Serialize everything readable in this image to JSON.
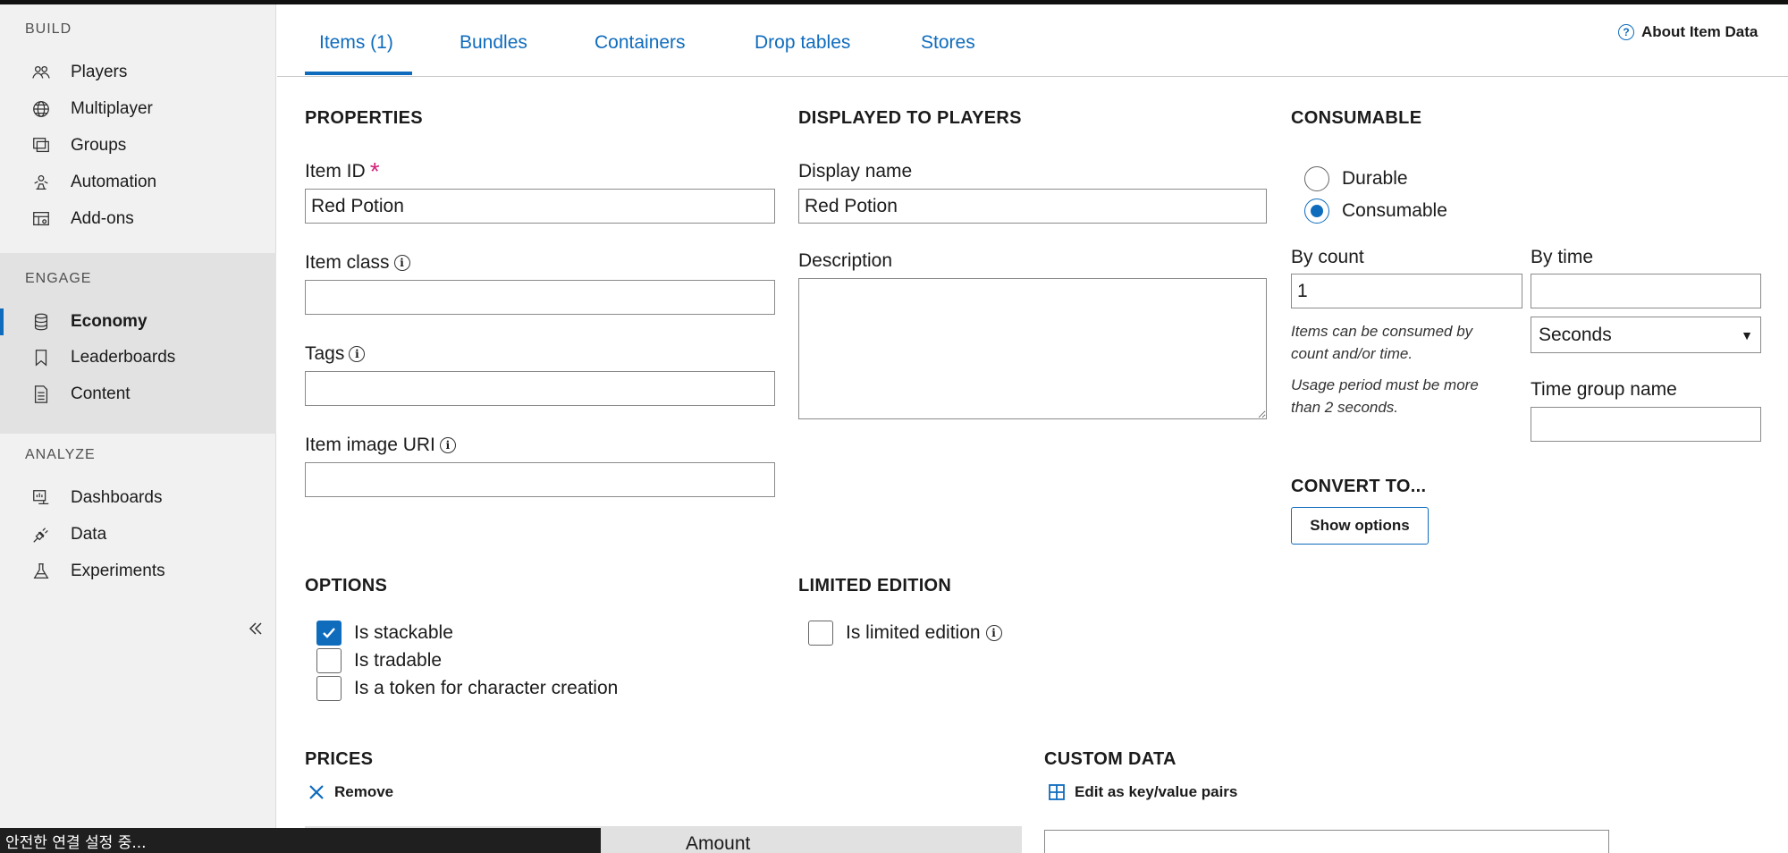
{
  "sidebar": {
    "build_title": "BUILD",
    "engage_title": "ENGAGE",
    "analyze_title": "ANALYZE",
    "build_items": [
      {
        "label": "Players",
        "icon": "players-icon"
      },
      {
        "label": "Multiplayer",
        "icon": "globe-icon"
      },
      {
        "label": "Groups",
        "icon": "groups-icon"
      },
      {
        "label": "Automation",
        "icon": "automation-icon"
      },
      {
        "label": "Add-ons",
        "icon": "add-ons-icon"
      }
    ],
    "engage_items": [
      {
        "label": "Economy",
        "icon": "database-icon",
        "active": true
      },
      {
        "label": "Leaderboards",
        "icon": "bookmark-icon"
      },
      {
        "label": "Content",
        "icon": "document-icon"
      }
    ],
    "analyze_items": [
      {
        "label": "Dashboards",
        "icon": "dashboard-icon"
      },
      {
        "label": "Data",
        "icon": "plug-icon"
      },
      {
        "label": "Experiments",
        "icon": "flask-icon"
      }
    ]
  },
  "tabs": [
    {
      "label": "Items (1)",
      "active": true
    },
    {
      "label": "Bundles"
    },
    {
      "label": "Containers"
    },
    {
      "label": "Drop tables"
    },
    {
      "label": "Stores"
    }
  ],
  "about_link": "About Item Data",
  "properties": {
    "heading": "PROPERTIES",
    "item_id_label": "Item ID",
    "item_id_value": "Red Potion",
    "required_mark": "*",
    "item_class_label": "Item class",
    "item_class_value": "",
    "tags_label": "Tags",
    "tags_value": "",
    "image_uri_label": "Item image URI",
    "image_uri_value": ""
  },
  "displayed": {
    "heading": "DISPLAYED TO PLAYERS",
    "display_name_label": "Display name",
    "display_name_value": "Red Potion",
    "description_label": "Description",
    "description_value": ""
  },
  "consumable": {
    "heading": "CONSUMABLE",
    "options": [
      {
        "label": "Durable",
        "selected": false
      },
      {
        "label": "Consumable",
        "selected": true
      }
    ],
    "by_count_label": "By count",
    "by_count_value": "1",
    "by_time_label": "By time",
    "by_time_value": "",
    "hint1": "Items can be consumed by count and/or time.",
    "hint2": "Usage period must be more than 2 seconds.",
    "time_unit": "Seconds",
    "time_group_label": "Time group name",
    "time_group_value": ""
  },
  "convert": {
    "heading": "CONVERT TO...",
    "button": "Show options"
  },
  "options": {
    "heading": "OPTIONS",
    "checks": [
      {
        "label": "Is stackable",
        "checked": true
      },
      {
        "label": "Is tradable",
        "checked": false
      },
      {
        "label": "Is a token for character creation",
        "checked": false
      }
    ]
  },
  "limited": {
    "heading": "LIMITED EDITION",
    "label": "Is limited edition",
    "checked": false
  },
  "prices": {
    "heading": "PRICES",
    "remove": "Remove",
    "col_amount": "Amount"
  },
  "custom_data": {
    "heading": "CUSTOM DATA",
    "edit": "Edit as key/value pairs"
  },
  "status_text": "안전한 연결 설정 중..."
}
